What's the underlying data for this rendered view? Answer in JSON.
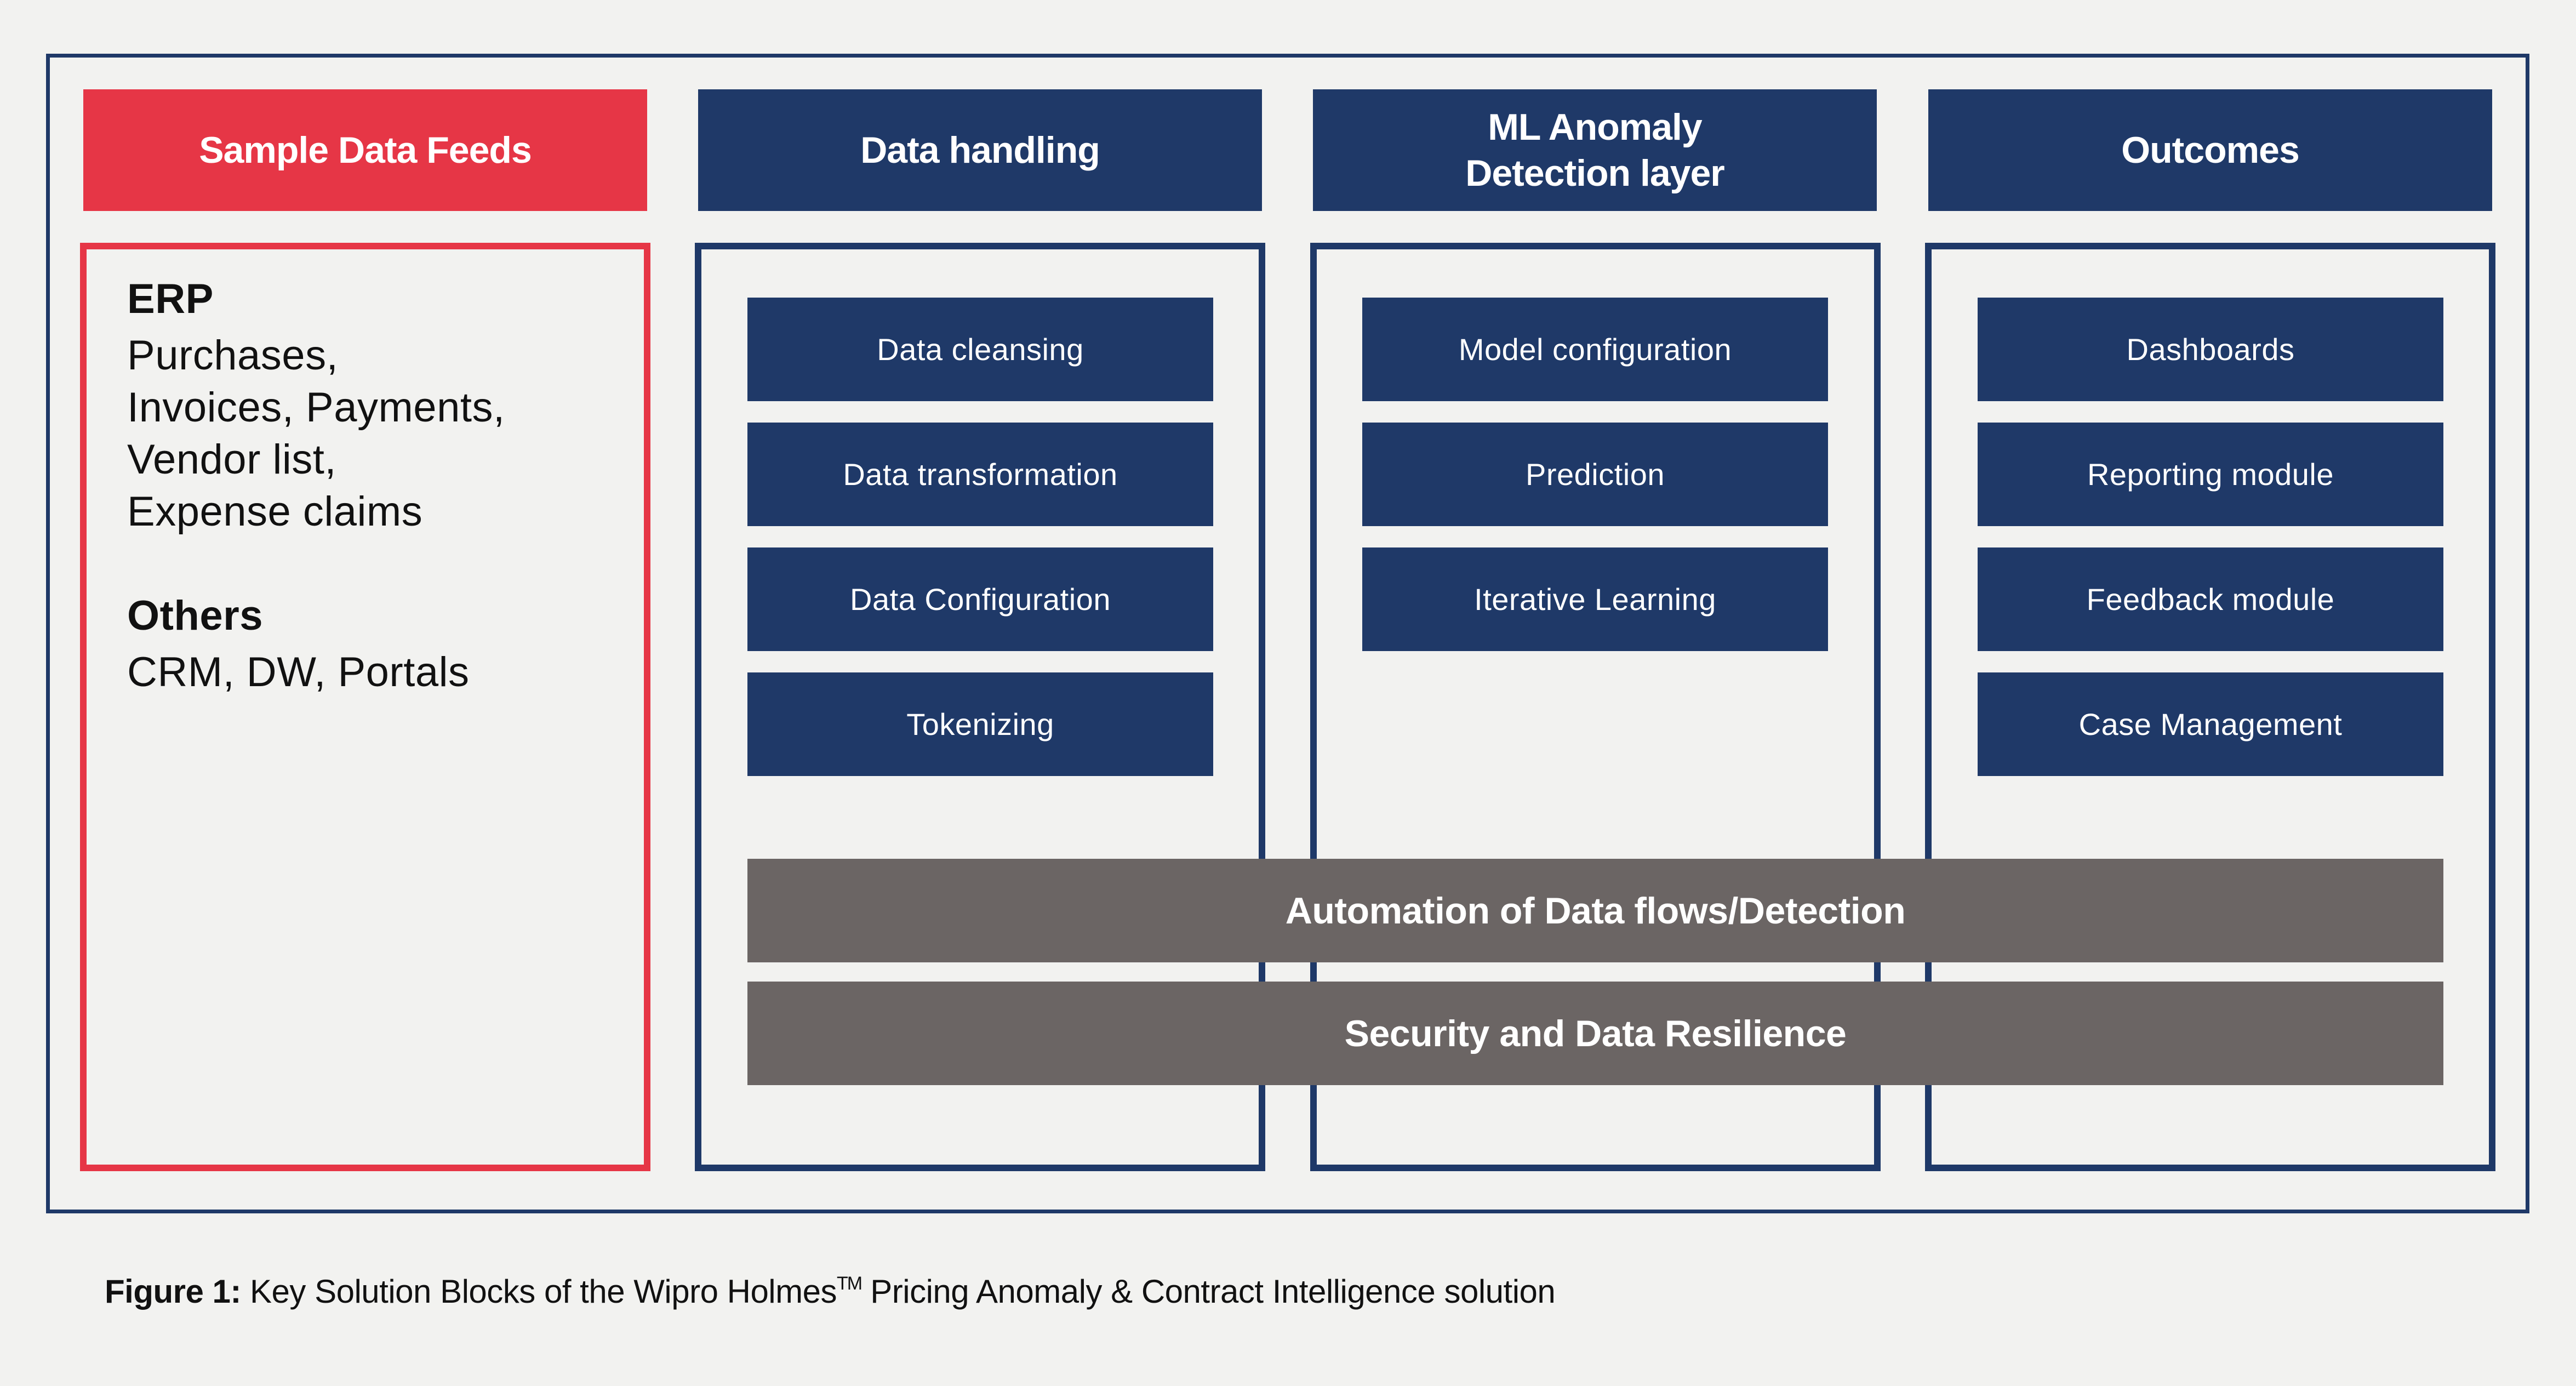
{
  "colors": {
    "navy": "#1f3968",
    "red": "#e63646",
    "gray": "#6b6564",
    "background": "#f2f2f0"
  },
  "columns": [
    {
      "header": "Sample Data Feeds",
      "groups": [
        {
          "heading": "ERP",
          "lines": [
            "Purchases,",
            "Invoices, Payments,",
            "Vendor list,",
            "Expense claims"
          ]
        },
        {
          "heading": "Others",
          "lines": [
            "CRM, DW, Portals"
          ]
        }
      ]
    },
    {
      "header": "Data handling",
      "items": [
        "Data cleansing",
        "Data transformation",
        "Data Configuration",
        "Tokenizing"
      ]
    },
    {
      "header_lines": [
        "ML Anomaly",
        "Detection layer"
      ],
      "items": [
        "Model configuration",
        "Prediction",
        "Iterative Learning"
      ]
    },
    {
      "header": "Outcomes",
      "items": [
        "Dashboards",
        "Reporting module",
        "Feedback module",
        "Case Management"
      ]
    }
  ],
  "bars": [
    "Automation of Data flows/Detection",
    "Security and Data Resilience"
  ],
  "caption": {
    "label": "Figure 1:",
    "text_before_mark": " Key Solution Blocks of the Wipro Holmes",
    "mark": "TM",
    "text_after_mark": " Pricing Anomaly & Contract Intelligence solution"
  }
}
